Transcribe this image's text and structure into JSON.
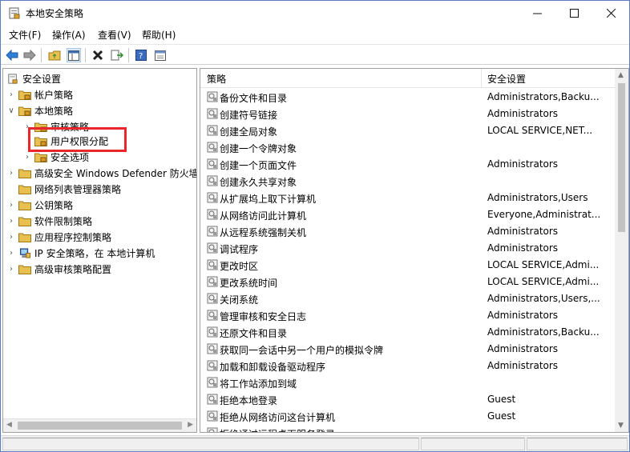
{
  "window": {
    "title": "本地安全策略"
  },
  "menu": [
    "文件(F)",
    "操作(A)",
    "查看(V)",
    "帮助(H)"
  ],
  "toolbar_icons": [
    "back-arrow-icon",
    "forward-arrow-icon",
    "up-folder-icon",
    "show-hide-tree-icon",
    "delete-icon",
    "export-list-icon",
    "help-icon",
    "properties-icon"
  ],
  "tree": {
    "root": "安全设置",
    "items": [
      {
        "label": "帐户策略",
        "level": 1,
        "expanded": false
      },
      {
        "label": "本地策略",
        "level": 1,
        "expanded": true
      },
      {
        "label": "审核策略",
        "level": 2,
        "expanded": false
      },
      {
        "label": "用户权限分配",
        "level": 2,
        "selected": true
      },
      {
        "label": "安全选项",
        "level": 2,
        "expanded": false
      },
      {
        "label": "高级安全 Windows Defender 防火墙",
        "level": 1,
        "expanded": false
      },
      {
        "label": "网络列表管理器策略",
        "level": 1
      },
      {
        "label": "公钥策略",
        "level": 1,
        "expanded": false
      },
      {
        "label": "软件限制策略",
        "level": 1,
        "expanded": false
      },
      {
        "label": "应用程序控制策略",
        "level": 1,
        "expanded": false
      },
      {
        "label": "IP 安全策略，在 本地计算机",
        "level": 1
      },
      {
        "label": "高级审核策略配置",
        "level": 1,
        "expanded": false
      }
    ]
  },
  "list": {
    "columns": [
      "策略",
      "安全设置"
    ],
    "rows": [
      {
        "policy": "备份文件和目录",
        "setting": "Administrators,Backu..."
      },
      {
        "policy": "创建符号链接",
        "setting": "Administrators"
      },
      {
        "policy": "创建全局对象",
        "setting": "LOCAL SERVICE,NET..."
      },
      {
        "policy": "创建一个令牌对象",
        "setting": ""
      },
      {
        "policy": "创建一个页面文件",
        "setting": "Administrators"
      },
      {
        "policy": "创建永久共享对象",
        "setting": ""
      },
      {
        "policy": "从扩展坞上取下计算机",
        "setting": "Administrators,Users"
      },
      {
        "policy": "从网络访问此计算机",
        "setting": "Everyone,Administrat..."
      },
      {
        "policy": "从远程系统强制关机",
        "setting": "Administrators"
      },
      {
        "policy": "调试程序",
        "setting": "Administrators"
      },
      {
        "policy": "更改时区",
        "setting": "LOCAL SERVICE,Admi..."
      },
      {
        "policy": "更改系统时间",
        "setting": "LOCAL SERVICE,Admi..."
      },
      {
        "policy": "关闭系统",
        "setting": "Administrators,Users,..."
      },
      {
        "policy": "管理审核和安全日志",
        "setting": "Administrators"
      },
      {
        "policy": "还原文件和目录",
        "setting": "Administrators,Backu..."
      },
      {
        "policy": "获取同一会话中另一个用户的模拟令牌",
        "setting": "Administrators"
      },
      {
        "policy": "加载和卸载设备驱动程序",
        "setting": "Administrators"
      },
      {
        "policy": "将工作站添加到域",
        "setting": ""
      },
      {
        "policy": "拒绝本地登录",
        "setting": "Guest"
      },
      {
        "policy": "拒绝从网络访问这台计算机",
        "setting": "Guest"
      },
      {
        "policy": "拒绝通过远程桌面服务登录",
        "setting": ""
      }
    ]
  },
  "colors": {
    "highlight_border": "#e8262b",
    "folder": "#e8c050",
    "selection_box": "#e8262b"
  }
}
